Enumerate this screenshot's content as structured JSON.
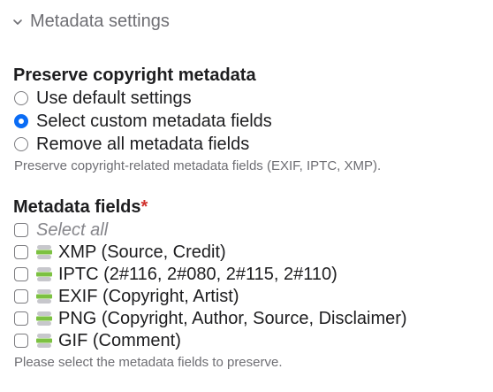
{
  "section": {
    "title": "Metadata settings"
  },
  "preserve": {
    "title": "Preserve copyright metadata",
    "options": [
      {
        "label": "Use default settings",
        "checked": false
      },
      {
        "label": "Select custom metadata fields",
        "checked": true
      },
      {
        "label": "Remove all metadata fields",
        "checked": false
      }
    ],
    "help": "Preserve copyright-related metadata fields (EXIF, IPTC, XMP)."
  },
  "fields": {
    "title": "Metadata fields",
    "required_mark": "*",
    "select_all": "Select all",
    "items": [
      {
        "label": "XMP (Source, Credit)",
        "checked": false,
        "icon": "status-stack-icon"
      },
      {
        "label": "IPTC (2#116, 2#080, 2#115, 2#110)",
        "checked": false,
        "icon": "status-stack-icon"
      },
      {
        "label": "EXIF (Copyright, Artist)",
        "checked": false,
        "icon": "status-stack-icon"
      },
      {
        "label": "PNG (Copyright, Author, Source, Disclaimer)",
        "checked": false,
        "icon": "status-stack-icon"
      },
      {
        "label": "GIF (Comment)",
        "checked": false,
        "icon": "status-stack-icon"
      }
    ],
    "help": "Please select the metadata fields to preserve."
  },
  "colors": {
    "accent": "#0a6cf5",
    "required": "#d0312d",
    "status_green": "#7cc142",
    "status_gray": "#c7c7cc"
  }
}
